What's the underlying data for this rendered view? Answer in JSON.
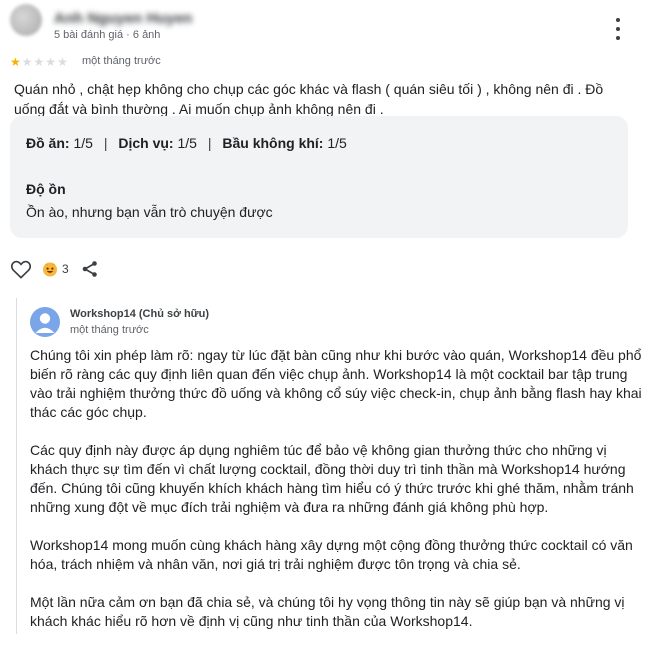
{
  "review": {
    "author_name": "Anh Nguyen Huyen",
    "author_meta": "5 bài đánh giá · 6 ảnh",
    "rating": 1,
    "rating_max": 5,
    "time": "một tháng trước",
    "text": "Quán nhỏ , chật hẹp không cho chụp các góc khác và flash ( quán siêu tối ) , không nên đi . Đồ uống đắt và bình thường . Ai muốn chụp ảnh không nên đi ."
  },
  "ratings": {
    "food_label": "Đồ ăn:",
    "food_value": "1/5",
    "service_label": "Dịch vụ:",
    "service_value": "1/5",
    "atmosphere_label": "Bầu không khí:",
    "atmosphere_value": "1/5",
    "separator": "|",
    "noise_label": "Độ ồn",
    "noise_value": "Ồn ào, nhưng bạn vẫn trò chuyện được"
  },
  "actions": {
    "reaction_count": "3",
    "icons": [
      "heart-icon",
      "emoji-reaction-icon",
      "share-icon",
      "more-vert-icon"
    ]
  },
  "owner_reply": {
    "name": "Workshop14 (Chủ sở hữu)",
    "time": "một tháng trước",
    "paragraphs": [
      "Chúng tôi xin phép làm rõ: ngay từ lúc đặt bàn cũng như khi bước vào quán, Workshop14 đều phổ biến rõ ràng các quy định liên quan đến việc chụp ảnh. Workshop14 là một cocktail bar tập trung vào trải nghiệm thưởng thức đồ uống và không cổ súy việc check-in, chụp ảnh bằng flash hay khai thác các góc chụp.",
      "Các quy định này được áp dụng nghiêm túc để bảo vệ không gian thưởng thức cho những vị khách thực sự tìm đến vì chất lượng cocktail, đồng thời duy trì tinh thần mà Workshop14 hướng đến. Chúng tôi cũng khuyến khích khách hàng tìm hiểu có ý thức trước khi ghé thăm, nhằm tránh những xung đột về mục đích trải nghiệm và đưa ra những đánh giá không phù hợp.",
      "Workshop14 mong muốn cùng khách hàng xây dựng một cộng đồng thưởng thức cocktail có văn hóa, trách nhiệm và nhân văn, nơi giá trị trải nghiệm được tôn trọng và chia sẻ.",
      "Một lần nữa cảm ơn bạn đã chia sẻ, và chúng tôi hy vọng thông tin này sẽ giúp bạn và những vị khách khác hiểu rõ hơn về định vị cũng như tinh thần của Workshop14."
    ]
  }
}
